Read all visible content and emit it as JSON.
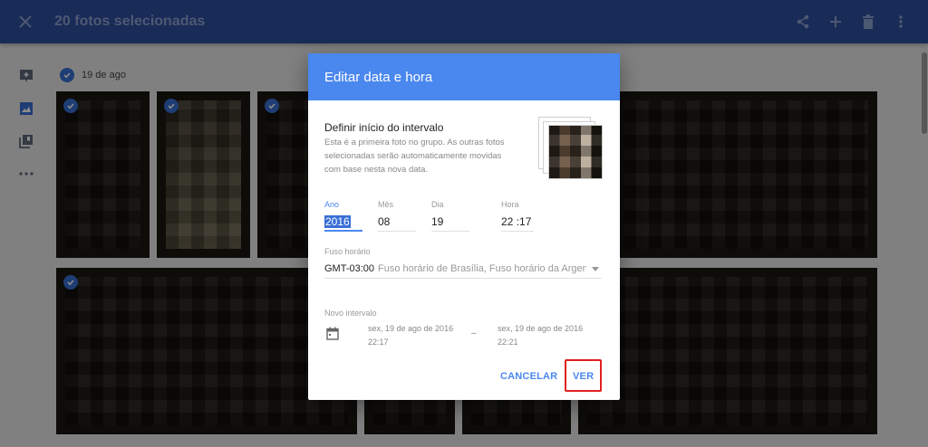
{
  "topbar": {
    "title": "20 fotos selecionadas",
    "close_icon": "close-icon",
    "actions": [
      "share-icon",
      "add-icon",
      "trash-icon",
      "more-vert-icon"
    ]
  },
  "rail": {
    "items": [
      "add-icon",
      "photo-icon",
      "albums-icon",
      "more-horiz-icon"
    ]
  },
  "content": {
    "date_label": "19 de ago"
  },
  "dialog": {
    "title": "Editar data e hora",
    "section_title": "Definir início do intervalo",
    "section_desc": "Esta é a primeira foto no grupo. As outras fotos selecionadas serão automaticamente movidas com base nesta nova data.",
    "fields": {
      "year": {
        "label": "Ano",
        "value": "2016"
      },
      "month": {
        "label": "Mês",
        "value": "08"
      },
      "day": {
        "label": "Dia",
        "value": "19"
      },
      "time": {
        "label": "Hora",
        "hour": "22",
        "sep": ":",
        "minute": "17"
      }
    },
    "timezone": {
      "label": "Fuso horário",
      "code": "GMT-03:00",
      "name": "Fuso horário de Brasília, Fuso horário da Argent..."
    },
    "interval": {
      "label": "Novo intervalo",
      "start_date": "sex, 19 de ago de 2016",
      "start_time": "22:17",
      "dash": "–",
      "end_date": "sex, 19 de ago de 2016",
      "end_time": "22:21"
    },
    "buttons": {
      "cancel": "CANCELAR",
      "ok": "VER"
    }
  },
  "colors": {
    "topbar": "#2e4f9e",
    "accent": "#4a87ee",
    "highlight_box": "#e02020"
  }
}
